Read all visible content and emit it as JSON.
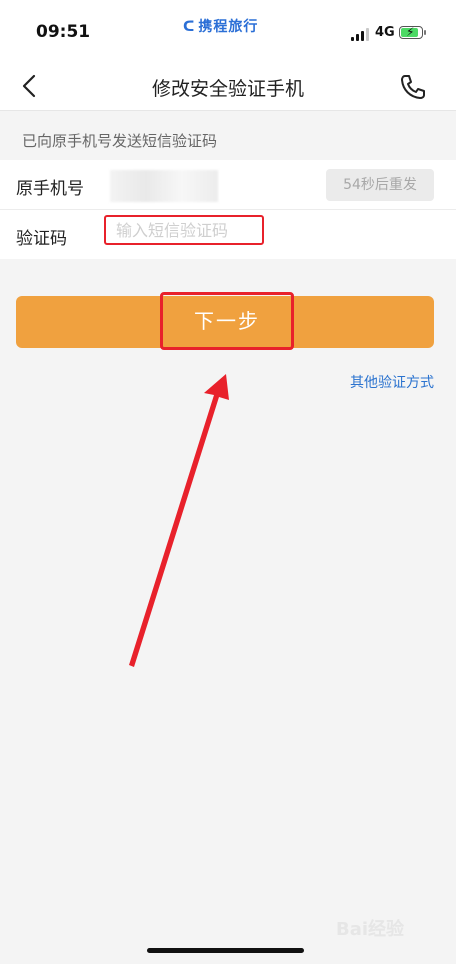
{
  "status_bar": {
    "time": "09:51",
    "app_brand": "携程旅行",
    "network": "4G"
  },
  "nav": {
    "title": "修改安全验证手机",
    "back_icon": "chevron-left-icon",
    "phone_icon": "phone-icon"
  },
  "form": {
    "hint": "已向原手机号发送短信验证码",
    "original_phone_label": "原手机号",
    "resend_label": "54秒后重发",
    "code_label": "验证码",
    "code_placeholder": "输入短信验证码",
    "code_value": ""
  },
  "actions": {
    "next_label": "下一步",
    "other_verify_link": "其他验证方式"
  },
  "colors": {
    "accent": "#f0a13f",
    "link": "#2b73cf",
    "annotation": "#e8212b"
  },
  "watermark": "Bai经验"
}
